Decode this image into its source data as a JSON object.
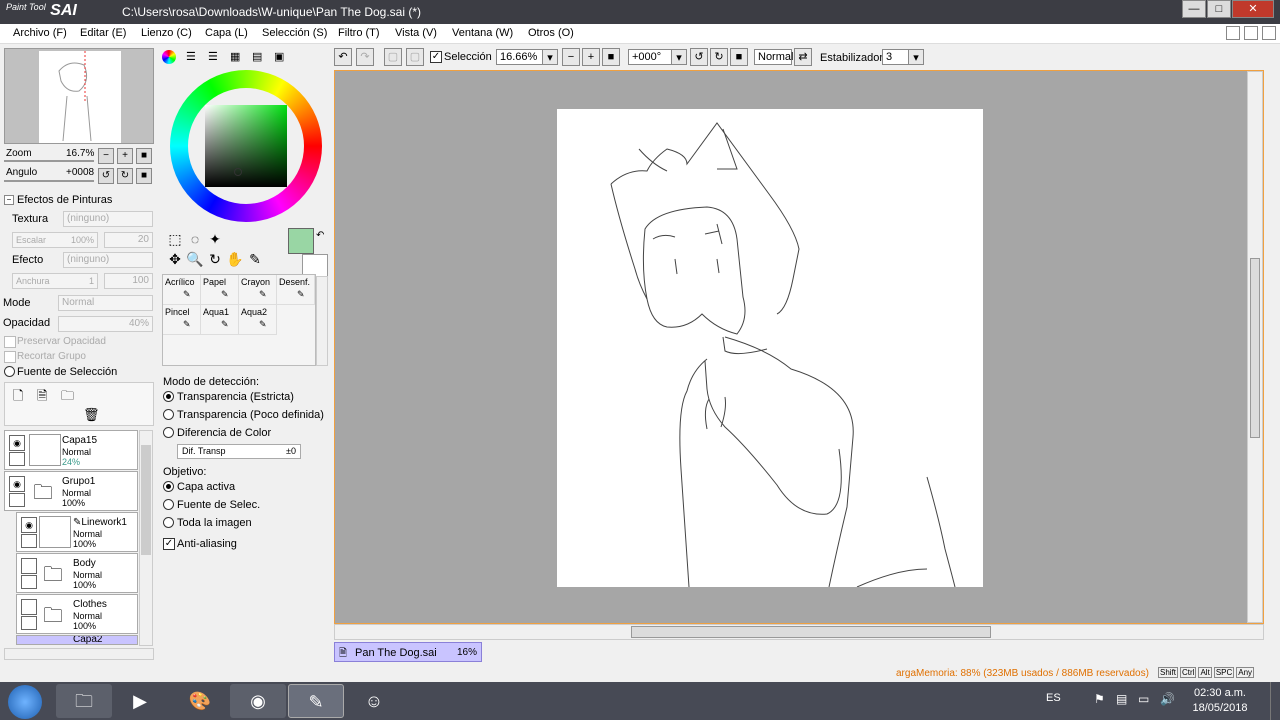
{
  "titlebar": {
    "logo_small": "Paint Tool",
    "logo": "SAI",
    "title": "C:\\Users\\rosa\\Downloads\\W-unique\\Pan The Dog.sai (*)",
    "min": "—",
    "max": "□",
    "close": "✕"
  },
  "menu": [
    "Archivo (F)",
    "Editar (E)",
    "Lienzo (C)",
    "Capa (L)",
    "Selección (S)",
    "Filtro (T)",
    "Vista (V)",
    "Ventana (W)",
    "Otros (O)"
  ],
  "navigator": {
    "zoom_label": "Zoom",
    "zoom_value": "16.7%",
    "angle_label": "Angulo",
    "angle_value": "+0008"
  },
  "effects": {
    "header": "Efectos de Pinturas",
    "texture_label": "Textura",
    "texture_value": "(ninguno)",
    "scale_label": "Escalar",
    "scale_value": "100%",
    "scale_value2": "20",
    "effect_label": "Efecto",
    "effect_value": "(ninguno)",
    "width_label": "Anchura",
    "width_value": "1",
    "width_value2": "100"
  },
  "layerprops": {
    "mode_label": "Mode",
    "mode_value": "Normal",
    "opacity_label": "Opacidad",
    "opacity_value": "40%",
    "preserve": "Preservar Opacidad",
    "clip": "Recortar Grupo",
    "selsource": "Fuente de Selección"
  },
  "layers": [
    {
      "name": "Capa15",
      "mode": "Normal",
      "opacity": "24%"
    },
    {
      "name": "Grupo1",
      "mode": "Normal",
      "opacity": "100%"
    },
    {
      "name": "Linework1",
      "mode": "Normal",
      "opacity": "100%"
    },
    {
      "name": "Body",
      "mode": "Normal",
      "opacity": "100%"
    },
    {
      "name": "Clothes",
      "mode": "Normal",
      "opacity": "100%"
    },
    {
      "name": "Capa2"
    }
  ],
  "colors": {
    "primary": "#99d6a4",
    "secondary": "#ffffff"
  },
  "brushes": [
    "Acrílico",
    "Papel",
    "Crayon",
    "Desenf.",
    "Pincel",
    "Aqua1",
    "Aqua2"
  ],
  "detection": {
    "header": "Modo de detección:",
    "opt1": "Transparencia (Estricta)",
    "opt2": "Transparencia (Poco definida)",
    "opt3": "Diferencia de Color",
    "diff_label": "Dif. Transp",
    "diff_value": "±0",
    "target_header": "Objetivo:",
    "t1": "Capa activa",
    "t2": "Fuente de Selec.",
    "t3": "Toda la imagen",
    "aa": "Anti-aliasing"
  },
  "toolbar": {
    "selection": "Selección",
    "zoom": "16.66%",
    "angle": "+000°",
    "mode": "Normal",
    "stab_label": "Estabilizador",
    "stab_value": "3"
  },
  "doc": {
    "name": "Pan The Dog.sai",
    "zoom": "16%"
  },
  "status": "argaMemoria: 88% (323MB usados / 886MB reservados)",
  "keys": [
    "Shift",
    "Ctrl",
    "Alt",
    "SPC",
    "Any"
  ],
  "tray": {
    "lang": "ES",
    "time": "02:30 a.m.",
    "date": "18/05/2018"
  }
}
